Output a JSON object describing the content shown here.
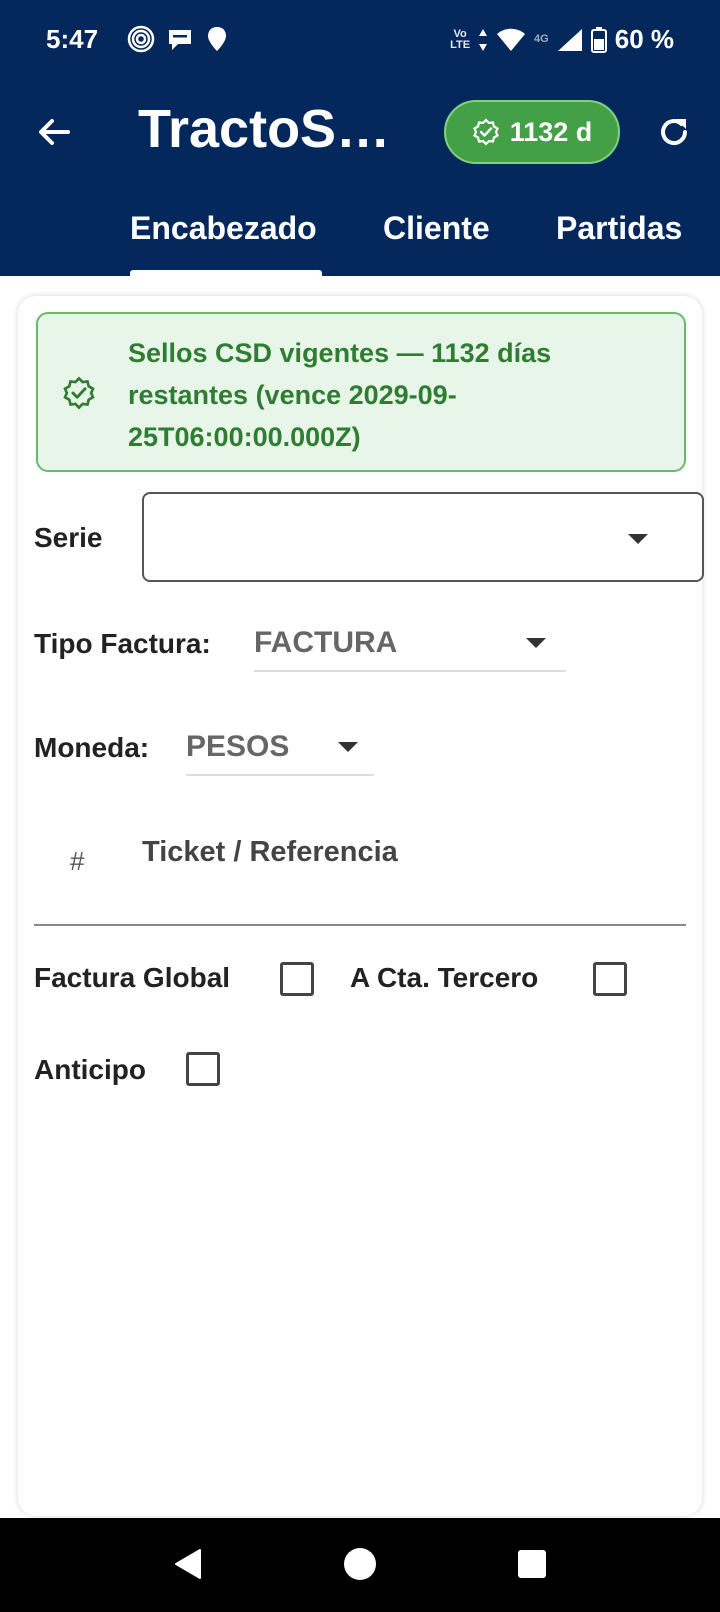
{
  "status_bar": {
    "time": "5:47",
    "battery": "60 %",
    "network": "4G",
    "volte_line1": "Vo",
    "volte_line2": "LTE"
  },
  "app_bar": {
    "title": "TractoSo...",
    "cert_days": "1132 d",
    "tabs": [
      "Encabezado",
      "Cliente",
      "Partidas"
    ],
    "active_tab": "Encabezado"
  },
  "alert": {
    "message": "Sellos CSD vigentes — 1132 días restantes (vence 2029-09-25T06:00:00.000Z)"
  },
  "form": {
    "serie_label": "Serie",
    "serie_value": "",
    "tipo_factura_label": "Tipo Factura:",
    "tipo_factura_value": "FACTURA",
    "moneda_label": "Moneda:",
    "moneda_value": "PESOS",
    "ticket_hash": "#",
    "ticket_placeholder": "Ticket / Referencia",
    "factura_global_label": "Factura Global",
    "a_cta_tercero_label": "A Cta. Tercero",
    "anticipo_label": "Anticipo"
  },
  "colors": {
    "app_bar": "#04285c",
    "chip_green": "#43a047",
    "alert_bg": "#e8f5e9",
    "alert_text": "#2e7d32"
  }
}
